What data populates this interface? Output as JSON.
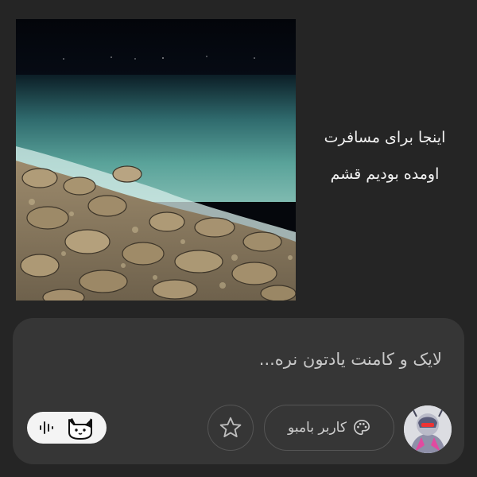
{
  "post": {
    "image_description_icon": "sea-shore-photo",
    "caption_lines": [
      "اینجا برای مسافرت",
      "اومده بودیم قشم"
    ]
  },
  "composer": {
    "text": "لایک و کامنت یادتون نره...",
    "user_chip_label": "کاربر بامبو",
    "user_chip_icon": "palette-icon",
    "star_icon": "star-icon",
    "mode_icons": [
      "voice-wave-icon",
      "cat-icon"
    ]
  },
  "colors": {
    "background": "#252525",
    "composer_bg": "#363636",
    "pill_bg": "#f4f4f4",
    "text_primary": "#f2f2f2",
    "text_secondary": "#c9c9c9"
  }
}
